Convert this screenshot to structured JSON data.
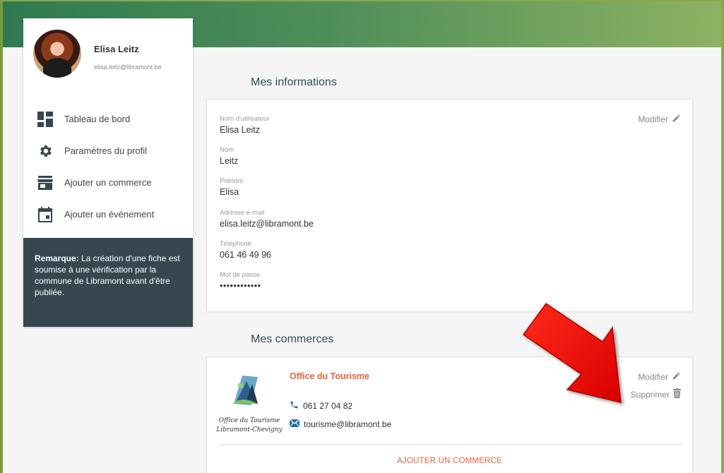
{
  "profile": {
    "name": "Elisa Leitz",
    "email": "elisa.leitz@libramont.be"
  },
  "menu": [
    {
      "label": "Tableau de bord",
      "icon": "dashboard-icon"
    },
    {
      "label": "Paramètres du profil",
      "icon": "gear-icon"
    },
    {
      "label": "Ajouter un commerce",
      "icon": "store-icon"
    },
    {
      "label": "Ajouter un événement",
      "icon": "calendar-icon"
    }
  ],
  "note": {
    "bold": "Remarque:",
    "text": " La création d'une fiche est soumise à une vérification par la commune de Libramont avant d'être publiée."
  },
  "info": {
    "title": "Mes informations",
    "edit_label": "Modifier",
    "fields": [
      {
        "label": "Nom d'utilisateur",
        "value": "Elisa Leitz"
      },
      {
        "label": "Nom",
        "value": "Leitz"
      },
      {
        "label": "Prénom",
        "value": "Elisa"
      },
      {
        "label": "Adresse e-mail",
        "value": "elisa.leitz@libramont.be"
      },
      {
        "label": "Téléphone",
        "value": "061 46 49 96"
      },
      {
        "label": "Mot de passe",
        "value": "••••••••••••"
      }
    ]
  },
  "commerces": {
    "title": "Mes commerces",
    "items": [
      {
        "name": "Office du Tourisme",
        "logo_text_1": "Office du Tourisme",
        "logo_text_2": "Libramont-Chevigny",
        "phone": "061 27 04 82",
        "email": "tourisme@libramont.be"
      }
    ],
    "edit_label": "Modifier",
    "delete_label": "Supprimer",
    "add_label": "AJOUTER UN COMMERCE"
  },
  "colors": {
    "accent": "#e8623a",
    "note_bg": "#37474f",
    "banner_start": "#2f7a4f",
    "banner_end": "#8db262",
    "annotation_arrow": "#e60000"
  }
}
